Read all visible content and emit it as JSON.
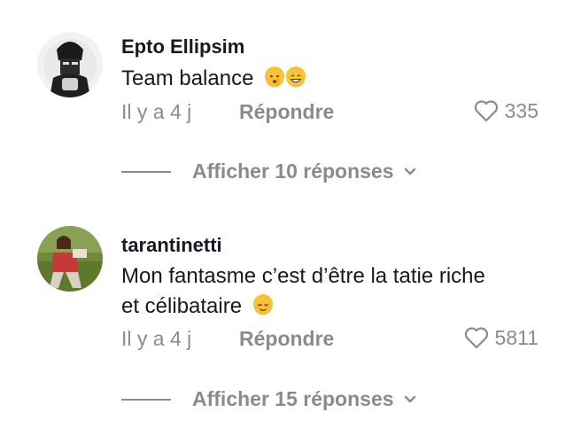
{
  "colors": {
    "primary_text": "#161823",
    "secondary_text": "#8a8b91"
  },
  "comments": [
    {
      "username": "Epto Ellipsim",
      "text": "Team balance",
      "emojis": [
        "shushing-face",
        "grinning-face"
      ],
      "time": "Il y a 4 j",
      "reply_label": "Répondre",
      "likes": "335",
      "view_replies": "Afficher 10 réponses"
    },
    {
      "username": "tarantinetti",
      "text_line1": "Mon fantasme c’est d’être la tatie riche",
      "text_line2": "et célibataire",
      "emojis": [
        "relieved-face"
      ],
      "time": "Il y a 4 j",
      "reply_label": "Répondre",
      "likes": "5811",
      "view_replies": "Afficher 15 réponses"
    }
  ]
}
